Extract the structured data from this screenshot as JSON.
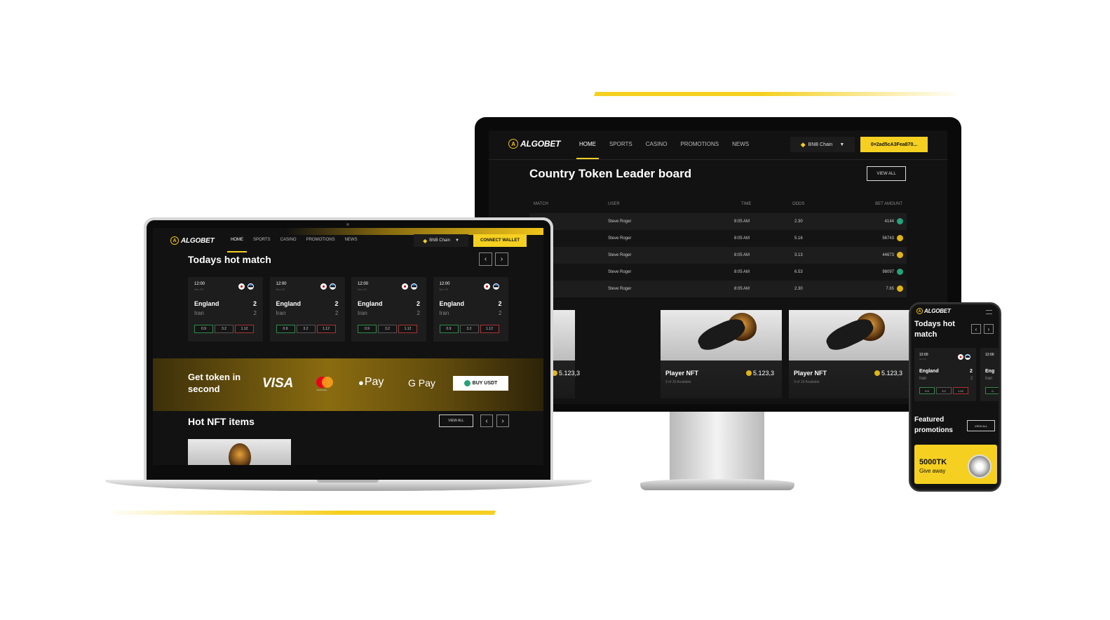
{
  "brand": "ALGOBET",
  "nav": [
    "HOME",
    "SPORTS",
    "CASINO",
    "PROMOTIONS",
    "NEWS"
  ],
  "chain": "BNB Chain",
  "wallet_address": "0×2ad5cA3Fea870...",
  "connect_wallet": "CONNECT WALLET",
  "leaderboard": {
    "title": "Country Token Leader board",
    "view_all": "VIEW ALL",
    "headers": [
      "MATCH",
      "USER",
      "TIME",
      "ODDS",
      "BET AMOUNT"
    ],
    "rows": [
      {
        "user": "Steve Roger",
        "time": "8:05 AM",
        "odds": "2.30",
        "amount": "4144",
        "coin": "usdt"
      },
      {
        "user": "Steve Roger",
        "time": "8:05 AM",
        "odds": "5.16",
        "amount": "56743",
        "coin": "gold"
      },
      {
        "user": "Steve Roger",
        "time": "8:05 AM",
        "odds": "3.13",
        "amount": "44673",
        "coin": "gold"
      },
      {
        "user": "Steve Roger",
        "time": "8:05 AM",
        "odds": "6.53",
        "amount": "98097",
        "coin": "usdt"
      },
      {
        "user": "Steve Roger",
        "time": "8:05 AM",
        "odds": "2.30",
        "amount": "7.65",
        "coin": "gold"
      }
    ]
  },
  "nft": {
    "title": "Hot NFT items",
    "view_all": "VIEW ALL",
    "items": [
      {
        "name": "r NFT",
        "price": "5.123,3",
        "avail": "vailable"
      },
      {
        "name": "Player NFT",
        "price": "5.123,3",
        "avail": "3 of 10 Available"
      },
      {
        "name": "Player NFT",
        "price": "5.123,3",
        "avail": "3 of 10 Available"
      }
    ]
  },
  "hot_match": {
    "title": "Todays hot match",
    "mobile_title": "Todays hot match",
    "matches": [
      {
        "time": "12:00",
        "date": "Nov 20",
        "team1": "England",
        "score1": "2",
        "team2": "Iran",
        "score2": "2",
        "odds": [
          "0.9",
          "3.2",
          "1.12"
        ]
      },
      {
        "time": "12:00",
        "date": "Nov 20",
        "team1": "England",
        "score1": "2",
        "team2": "Iran",
        "score2": "2",
        "odds": [
          "0.9",
          "3.2",
          "1.12"
        ]
      },
      {
        "time": "12:00",
        "date": "Nov 20",
        "team1": "England",
        "score1": "2",
        "team2": "Iran",
        "score2": "2",
        "odds": [
          "0.9",
          "3.2",
          "1.12"
        ]
      },
      {
        "time": "12:00",
        "date": "Nov 20",
        "team1": "England",
        "score1": "2",
        "team2": "Iran",
        "score2": "2",
        "odds": [
          "0.9",
          "3.2",
          "1.12"
        ]
      }
    ],
    "mobile_partial": {
      "team1": "Eng",
      "team2": "Iran",
      "odd": "0."
    }
  },
  "token_banner": {
    "title": "Get token in second",
    "payments": [
      "VISA",
      "mastercard",
      "Pay",
      "G Pay"
    ],
    "buy": "BUY USDT"
  },
  "promotions": {
    "title": "Featured promotions",
    "view_all": "VIEW ALL",
    "promo_amount": "5000TK",
    "promo_sub": "Give away"
  },
  "colors": {
    "accent": "#f5d021",
    "bg": "#111111",
    "card": "#1d1d1d",
    "win": "#2f8a4a",
    "loss": "#aa3333"
  }
}
